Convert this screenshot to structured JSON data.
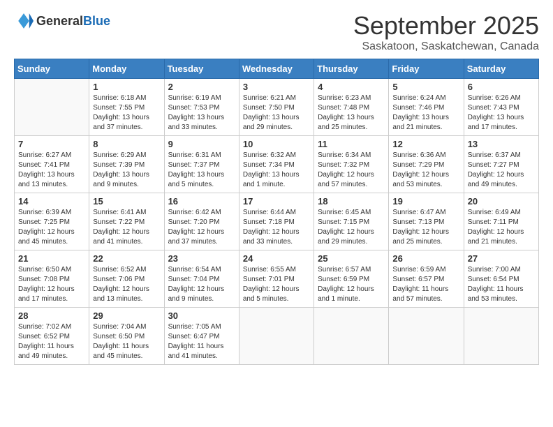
{
  "header": {
    "logo_general": "General",
    "logo_blue": "Blue",
    "month": "September 2025",
    "location": "Saskatoon, Saskatchewan, Canada"
  },
  "days_of_week": [
    "Sunday",
    "Monday",
    "Tuesday",
    "Wednesday",
    "Thursday",
    "Friday",
    "Saturday"
  ],
  "weeks": [
    [
      {
        "day": "",
        "sunrise": "",
        "sunset": "",
        "daylight": ""
      },
      {
        "day": "1",
        "sunrise": "Sunrise: 6:18 AM",
        "sunset": "Sunset: 7:55 PM",
        "daylight": "Daylight: 13 hours and 37 minutes."
      },
      {
        "day": "2",
        "sunrise": "Sunrise: 6:19 AM",
        "sunset": "Sunset: 7:53 PM",
        "daylight": "Daylight: 13 hours and 33 minutes."
      },
      {
        "day": "3",
        "sunrise": "Sunrise: 6:21 AM",
        "sunset": "Sunset: 7:50 PM",
        "daylight": "Daylight: 13 hours and 29 minutes."
      },
      {
        "day": "4",
        "sunrise": "Sunrise: 6:23 AM",
        "sunset": "Sunset: 7:48 PM",
        "daylight": "Daylight: 13 hours and 25 minutes."
      },
      {
        "day": "5",
        "sunrise": "Sunrise: 6:24 AM",
        "sunset": "Sunset: 7:46 PM",
        "daylight": "Daylight: 13 hours and 21 minutes."
      },
      {
        "day": "6",
        "sunrise": "Sunrise: 6:26 AM",
        "sunset": "Sunset: 7:43 PM",
        "daylight": "Daylight: 13 hours and 17 minutes."
      }
    ],
    [
      {
        "day": "7",
        "sunrise": "Sunrise: 6:27 AM",
        "sunset": "Sunset: 7:41 PM",
        "daylight": "Daylight: 13 hours and 13 minutes."
      },
      {
        "day": "8",
        "sunrise": "Sunrise: 6:29 AM",
        "sunset": "Sunset: 7:39 PM",
        "daylight": "Daylight: 13 hours and 9 minutes."
      },
      {
        "day": "9",
        "sunrise": "Sunrise: 6:31 AM",
        "sunset": "Sunset: 7:37 PM",
        "daylight": "Daylight: 13 hours and 5 minutes."
      },
      {
        "day": "10",
        "sunrise": "Sunrise: 6:32 AM",
        "sunset": "Sunset: 7:34 PM",
        "daylight": "Daylight: 13 hours and 1 minute."
      },
      {
        "day": "11",
        "sunrise": "Sunrise: 6:34 AM",
        "sunset": "Sunset: 7:32 PM",
        "daylight": "Daylight: 12 hours and 57 minutes."
      },
      {
        "day": "12",
        "sunrise": "Sunrise: 6:36 AM",
        "sunset": "Sunset: 7:29 PM",
        "daylight": "Daylight: 12 hours and 53 minutes."
      },
      {
        "day": "13",
        "sunrise": "Sunrise: 6:37 AM",
        "sunset": "Sunset: 7:27 PM",
        "daylight": "Daylight: 12 hours and 49 minutes."
      }
    ],
    [
      {
        "day": "14",
        "sunrise": "Sunrise: 6:39 AM",
        "sunset": "Sunset: 7:25 PM",
        "daylight": "Daylight: 12 hours and 45 minutes."
      },
      {
        "day": "15",
        "sunrise": "Sunrise: 6:41 AM",
        "sunset": "Sunset: 7:22 PM",
        "daylight": "Daylight: 12 hours and 41 minutes."
      },
      {
        "day": "16",
        "sunrise": "Sunrise: 6:42 AM",
        "sunset": "Sunset: 7:20 PM",
        "daylight": "Daylight: 12 hours and 37 minutes."
      },
      {
        "day": "17",
        "sunrise": "Sunrise: 6:44 AM",
        "sunset": "Sunset: 7:18 PM",
        "daylight": "Daylight: 12 hours and 33 minutes."
      },
      {
        "day": "18",
        "sunrise": "Sunrise: 6:45 AM",
        "sunset": "Sunset: 7:15 PM",
        "daylight": "Daylight: 12 hours and 29 minutes."
      },
      {
        "day": "19",
        "sunrise": "Sunrise: 6:47 AM",
        "sunset": "Sunset: 7:13 PM",
        "daylight": "Daylight: 12 hours and 25 minutes."
      },
      {
        "day": "20",
        "sunrise": "Sunrise: 6:49 AM",
        "sunset": "Sunset: 7:11 PM",
        "daylight": "Daylight: 12 hours and 21 minutes."
      }
    ],
    [
      {
        "day": "21",
        "sunrise": "Sunrise: 6:50 AM",
        "sunset": "Sunset: 7:08 PM",
        "daylight": "Daylight: 12 hours and 17 minutes."
      },
      {
        "day": "22",
        "sunrise": "Sunrise: 6:52 AM",
        "sunset": "Sunset: 7:06 PM",
        "daylight": "Daylight: 12 hours and 13 minutes."
      },
      {
        "day": "23",
        "sunrise": "Sunrise: 6:54 AM",
        "sunset": "Sunset: 7:04 PM",
        "daylight": "Daylight: 12 hours and 9 minutes."
      },
      {
        "day": "24",
        "sunrise": "Sunrise: 6:55 AM",
        "sunset": "Sunset: 7:01 PM",
        "daylight": "Daylight: 12 hours and 5 minutes."
      },
      {
        "day": "25",
        "sunrise": "Sunrise: 6:57 AM",
        "sunset": "Sunset: 6:59 PM",
        "daylight": "Daylight: 12 hours and 1 minute."
      },
      {
        "day": "26",
        "sunrise": "Sunrise: 6:59 AM",
        "sunset": "Sunset: 6:57 PM",
        "daylight": "Daylight: 11 hours and 57 minutes."
      },
      {
        "day": "27",
        "sunrise": "Sunrise: 7:00 AM",
        "sunset": "Sunset: 6:54 PM",
        "daylight": "Daylight: 11 hours and 53 minutes."
      }
    ],
    [
      {
        "day": "28",
        "sunrise": "Sunrise: 7:02 AM",
        "sunset": "Sunset: 6:52 PM",
        "daylight": "Daylight: 11 hours and 49 minutes."
      },
      {
        "day": "29",
        "sunrise": "Sunrise: 7:04 AM",
        "sunset": "Sunset: 6:50 PM",
        "daylight": "Daylight: 11 hours and 45 minutes."
      },
      {
        "day": "30",
        "sunrise": "Sunrise: 7:05 AM",
        "sunset": "Sunset: 6:47 PM",
        "daylight": "Daylight: 11 hours and 41 minutes."
      },
      {
        "day": "",
        "sunrise": "",
        "sunset": "",
        "daylight": ""
      },
      {
        "day": "",
        "sunrise": "",
        "sunset": "",
        "daylight": ""
      },
      {
        "day": "",
        "sunrise": "",
        "sunset": "",
        "daylight": ""
      },
      {
        "day": "",
        "sunrise": "",
        "sunset": "",
        "daylight": ""
      }
    ]
  ]
}
